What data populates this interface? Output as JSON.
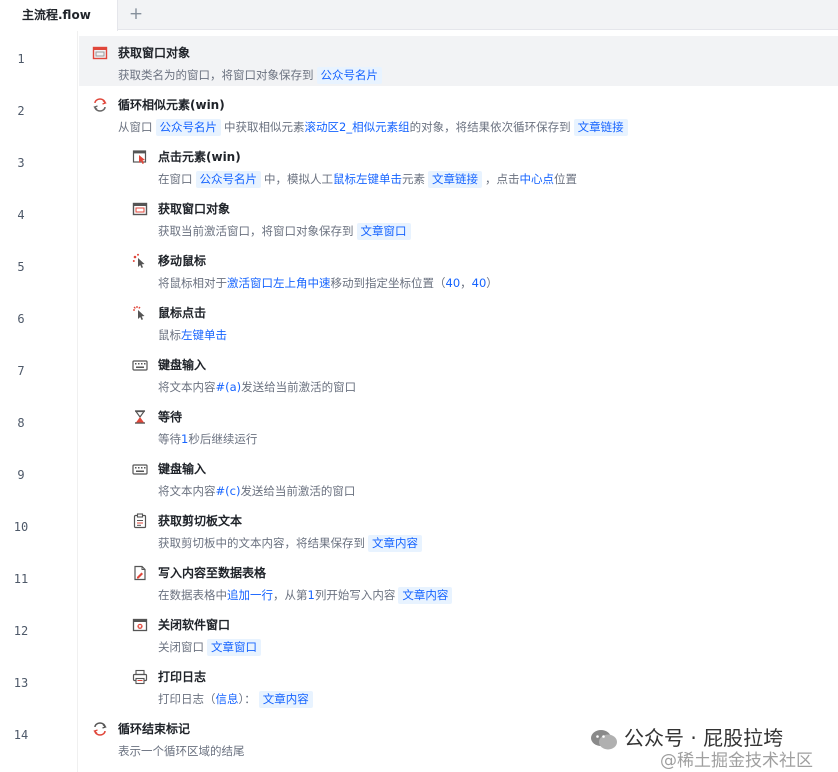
{
  "tab": {
    "label": "主流程.flow",
    "add_label": "+"
  },
  "line_numbers": [
    "1",
    "2",
    "3",
    "4",
    "5",
    "6",
    "7",
    "8",
    "9",
    "10",
    "11",
    "12",
    "13",
    "14"
  ],
  "steps": [
    {
      "title": "获取窗口对象",
      "desc": [
        "获取类名为的窗口，将窗口对象保存到"
      ],
      "tags": [
        "公众号名片"
      ]
    },
    {
      "title": "循环相似元素(win)",
      "desc": [
        "从窗口",
        "中获取相似元素",
        "滚动区2_相似元素组",
        "的对象，将结果依次循环保存到"
      ],
      "tags": [
        "公众号名片",
        "文章链接"
      ]
    },
    {
      "title": "点击元素(win)",
      "desc": [
        "在窗口",
        "中，模拟人工",
        "鼠标左键单击",
        "元素",
        "，点击",
        "中心点",
        "位置"
      ],
      "tags": [
        "公众号名片",
        "文章链接"
      ]
    },
    {
      "title": "获取窗口对象",
      "desc": [
        "获取当前激活窗口，将窗口对象保存到"
      ],
      "tags": [
        "文章窗口"
      ]
    },
    {
      "title": "移动鼠标",
      "desc": [
        "将鼠标相对于",
        "激活窗口左上角中速",
        "移动到指定坐标位置（",
        "40",
        "，",
        "40",
        "）"
      ]
    },
    {
      "title": "鼠标点击",
      "desc": [
        "鼠标",
        "左键单击"
      ]
    },
    {
      "title": "键盘输入",
      "desc": [
        "将文本内容",
        "#(a)",
        "发送给当前激活的窗口"
      ]
    },
    {
      "title": "等待",
      "desc": [
        "等待",
        "1",
        "秒后继续运行"
      ]
    },
    {
      "title": "键盘输入",
      "desc": [
        "将文本内容",
        "#(c)",
        "发送给当前激活的窗口"
      ]
    },
    {
      "title": "获取剪切板文本",
      "desc": [
        "获取剪切板中的文本内容，将结果保存到"
      ],
      "tags": [
        "文章内容"
      ]
    },
    {
      "title": "写入内容至数据表格",
      "desc": [
        "在数据表格中",
        "追加一行",
        "，从第",
        "1",
        "列开始写入内容"
      ],
      "tags": [
        "文章内容"
      ]
    },
    {
      "title": "关闭软件窗口",
      "desc": [
        "关闭窗口"
      ],
      "tags": [
        "文章窗口"
      ]
    },
    {
      "title": "打印日志",
      "desc": [
        "打印日志（",
        "信息",
        "）："
      ],
      "tags": [
        "文章内容"
      ]
    },
    {
      "title": "循环结束标记",
      "desc": [
        "表示一个循环区域的结尾"
      ]
    }
  ],
  "icons": [
    "window-icon",
    "loop-icon",
    "click-element-icon",
    "window-icon",
    "move-mouse-icon",
    "mouse-click-icon",
    "keyboard-icon",
    "hourglass-icon",
    "keyboard-icon",
    "clipboard-icon",
    "write-table-icon",
    "close-window-icon",
    "printer-icon",
    "loop-end-icon"
  ],
  "watermark": {
    "line1": "公众号 · 屁股拉垮",
    "line2": "@稀土掘金技术社区"
  },
  "colors": {
    "accent": "#1664ff",
    "tag_bg": "#e8f3ff",
    "icon_red": "#e0463a"
  }
}
